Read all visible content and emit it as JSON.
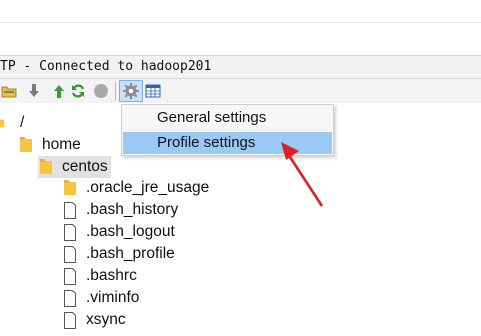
{
  "window": {
    "title": "TP - Connected to hadoop201"
  },
  "toolbar": {
    "icons": [
      "open-folder-icon",
      "download-icon",
      "upload-icon",
      "refresh-icon",
      "stop-icon",
      "settings-icon",
      "table-view-icon"
    ]
  },
  "menu": {
    "items": [
      {
        "label": "General settings"
      },
      {
        "label": "Profile settings"
      }
    ]
  },
  "tree": {
    "root": "/",
    "home": "home",
    "user": "centos",
    "children": [
      ".oracle_jre_usage",
      ".bash_history",
      ".bash_logout",
      ".bash_profile",
      ".bashrc",
      ".viminfo",
      "xsync"
    ]
  },
  "colors": {
    "menu_highlight": "#99c9f4",
    "selected_row": "#e1e1e1",
    "arrow": "#e02020",
    "folder": "#f5c542"
  }
}
